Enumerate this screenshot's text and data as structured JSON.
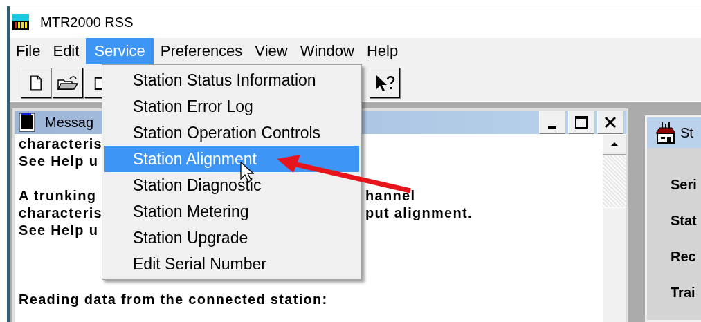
{
  "window": {
    "title": "MTR2000 RSS"
  },
  "menu_bar": [
    {
      "label": "File",
      "selected": false
    },
    {
      "label": "Edit",
      "selected": false
    },
    {
      "label": "Service",
      "selected": true
    },
    {
      "label": "Preferences",
      "selected": false
    },
    {
      "label": "View",
      "selected": false
    },
    {
      "label": "Window",
      "selected": false
    },
    {
      "label": "Help",
      "selected": false
    }
  ],
  "service_menu": [
    {
      "label": "Station Status Information",
      "selected": false
    },
    {
      "label": "Station Error Log",
      "selected": false
    },
    {
      "label": "Station Operation Controls",
      "selected": false
    },
    {
      "label": "Station Alignment",
      "selected": true
    },
    {
      "label": "Station Diagnostic",
      "selected": false
    },
    {
      "label": "Station Metering",
      "selected": false
    },
    {
      "label": "Station Upgrade",
      "selected": false
    },
    {
      "label": "Edit Serial Number",
      "selected": false
    }
  ],
  "message_window": {
    "title": "Messag",
    "paragraphs": [
      {
        "lines": [
          {
            "text": "characteris"
          },
          {
            "text": "See Help u"
          }
        ]
      },
      {
        "lines": [
          {
            "text": "A trunking",
            "tail": "hannel"
          },
          {
            "text": "characteris",
            "tail": "put alignment."
          },
          {
            "text": "See Help u"
          }
        ]
      },
      {
        "lines": [
          {
            "text": "Reading data from the connected station:"
          }
        ]
      }
    ]
  },
  "status_window": {
    "title": "St",
    "labels": [
      "Seri",
      "Stat",
      "Rec",
      "Trai"
    ]
  }
}
